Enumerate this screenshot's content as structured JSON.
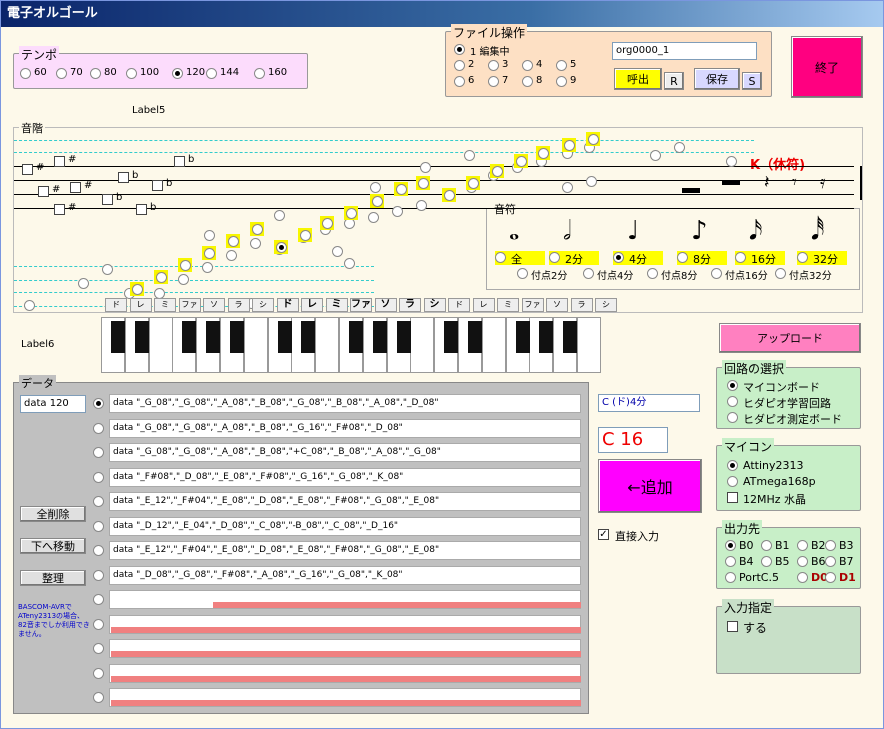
{
  "window_title": "電子オルゴール",
  "tempo": {
    "title": "テンポ",
    "options": [
      "60",
      "70",
      "80",
      "100",
      "120",
      "144",
      "160"
    ],
    "selected": "120"
  },
  "file_ops": {
    "title": "ファイル操作",
    "option1": "1 編集中",
    "options": [
      "2",
      "3",
      "4",
      "5",
      "6",
      "7",
      "8",
      "9"
    ],
    "filename": "org0000_1",
    "call_btn": "呼出",
    "r_btn": "R",
    "save_btn": "保存",
    "s_btn": "S"
  },
  "exit_btn": "終了",
  "label5": "Label5",
  "scale": {
    "title": "音階",
    "rest_label": "K（休符)",
    "sharp": "#",
    "flat": "b"
  },
  "note": {
    "title": "音符",
    "options": [
      "全",
      "2分",
      "4分",
      "8分",
      "16分",
      "32分"
    ],
    "selected": "4分",
    "dotted": [
      "付点2分",
      "付点4分",
      "付点8分",
      "付点16分",
      "付点32分"
    ]
  },
  "keys": [
    "ド",
    "レ",
    "ミ",
    "ファ",
    "ソ",
    "ラ",
    "シ",
    "ド",
    "レ",
    "ミ",
    "ファ",
    "ソ",
    "ラ",
    "シ",
    "ド",
    "レ",
    "ミ",
    "ファ",
    "ソ",
    "ラ",
    "シ"
  ],
  "label6": "Label6",
  "upload_btn": "アップロード",
  "circuit": {
    "title": "回路の選択",
    "options": [
      "マイコンボード",
      "ヒダピオ学習回路",
      "ヒダピオ測定ボード"
    ]
  },
  "mcu": {
    "title": "マイコン",
    "options": [
      "Attiny2313",
      "ATmega168p"
    ],
    "xtal": "12MHz 水晶"
  },
  "output": {
    "title": "出力先",
    "items": [
      "B0",
      "B1",
      "B2",
      "B3",
      "B4",
      "B5",
      "B6",
      "B7",
      "PortC.5",
      "D0",
      "D1"
    ]
  },
  "input_spec": {
    "title": "入力指定",
    "check": "する"
  },
  "data": {
    "title": "データ",
    "value": "data 120",
    "delete_all": "全削除",
    "move_down": "下へ移動",
    "arrange": "整理",
    "note_text": "BASCOM-AVRでATeny2313の場合、82音までしか利用できません。",
    "rows": [
      "data \"_G_08\",\"_G_08\",\"_A_08\",\"_B_08\",\"_G_08\",\"_B_08\",\"_A_08\",\"_D_08\"",
      "data \"_G_08\",\"_G_08\",\"_A_08\",\"_B_08\",\"_G_16\",\"_F#08\",\"_D_08\"",
      "data \"_G_08\",\"_G_08\",\"_A_08\",\"_B_08\",\"+C_08\",\"_B_08\",\"_A_08\",\"_G_08\"",
      "data \"_F#08\",\"_D_08\",\"_E_08\",\"_F#08\",\"_G_16\",\"_G_08\",\"_K_08\"",
      "data \"_E_12\",\"_F#04\",\"_E_08\",\"_D_08\",\"_E_08\",\"_F#08\",\"_G_08\",\"_E_08\"",
      "data \"_D_12\",\"_E_04\",\"_D_08\",\"_C_08\",\"-B_08\",\"_C_08\",\"_D_16\"",
      "data \"_E_12\",\"_F#04\",\"_E_08\",\"_D_08\",\"_E_08\",\"_F#08\",\"_G_08\",\"_E_08\"",
      "data \"_D_08\",\"_G_08\",\"_F#08\",\"_A_08\",\"_G_16\",\"_G_08\",\"_K_08\"",
      "",
      "",
      "",
      "",
      ""
    ]
  },
  "current_note": "C (ド)4分",
  "note_code": "C 16",
  "add_btn": "←追加",
  "direct_input": "直接入力",
  "colors": {
    "pink": "#ff0080",
    "magenta": "#ff00ff",
    "yellow": "#ffff00",
    "green_panel": "#c8efc8",
    "tempo_panel": "#fcdcfc",
    "file_panel": "#fde0c4"
  }
}
